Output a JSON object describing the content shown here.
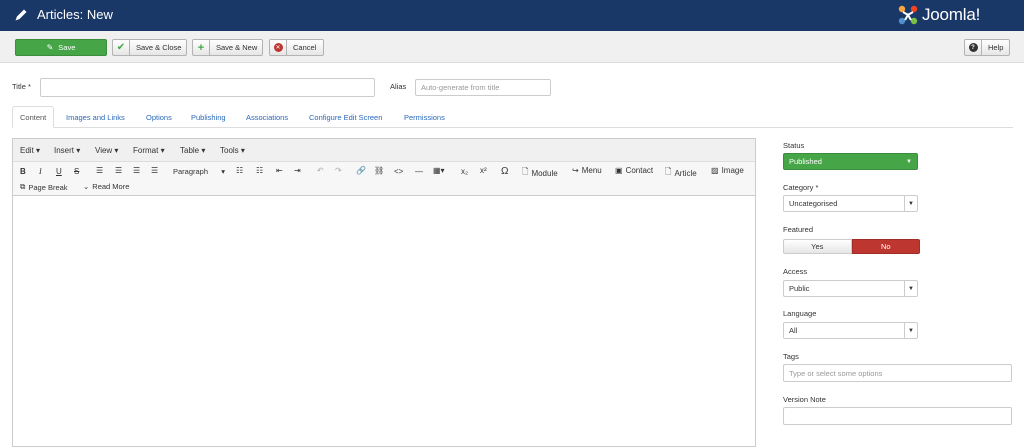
{
  "header": {
    "title": "Articles: New",
    "logo_text": "Joomla!",
    "bg": "#1a3867"
  },
  "toolbar": {
    "save": "Save",
    "save_close": "Save & Close",
    "save_new": "Save & New",
    "cancel": "Cancel",
    "help": "Help"
  },
  "form": {
    "title_label": "Title *",
    "title_value": "",
    "alias_label": "Alias",
    "alias_placeholder": "Auto-generate from title"
  },
  "tabs": [
    "Content",
    "Images and Links",
    "Options",
    "Publishing",
    "Associations",
    "Configure Edit Screen",
    "Permissions"
  ],
  "editor": {
    "menus": [
      "Edit",
      "Insert",
      "View",
      "Format",
      "Table",
      "Tools"
    ],
    "format_select": "Paragraph",
    "buttons": {
      "module": "Module",
      "menu": "Menu",
      "contact": "Contact",
      "article": "Article",
      "image": "Image",
      "page_break": "Page Break",
      "read_more": "Read More"
    }
  },
  "sidebar": {
    "status_label": "Status",
    "status_value": "Published",
    "category_label": "Category *",
    "category_value": "Uncategorised",
    "featured_label": "Featured",
    "yes": "Yes",
    "no": "No",
    "access_label": "Access",
    "access_value": "Public",
    "language_label": "Language",
    "language_value": "All",
    "tags_label": "Tags",
    "tags_placeholder": "Type or select some options",
    "version_label": "Version Note",
    "version_value": ""
  },
  "colors": {
    "success": "#46a546",
    "danger": "#bd362f",
    "link": "#2a69b8"
  }
}
